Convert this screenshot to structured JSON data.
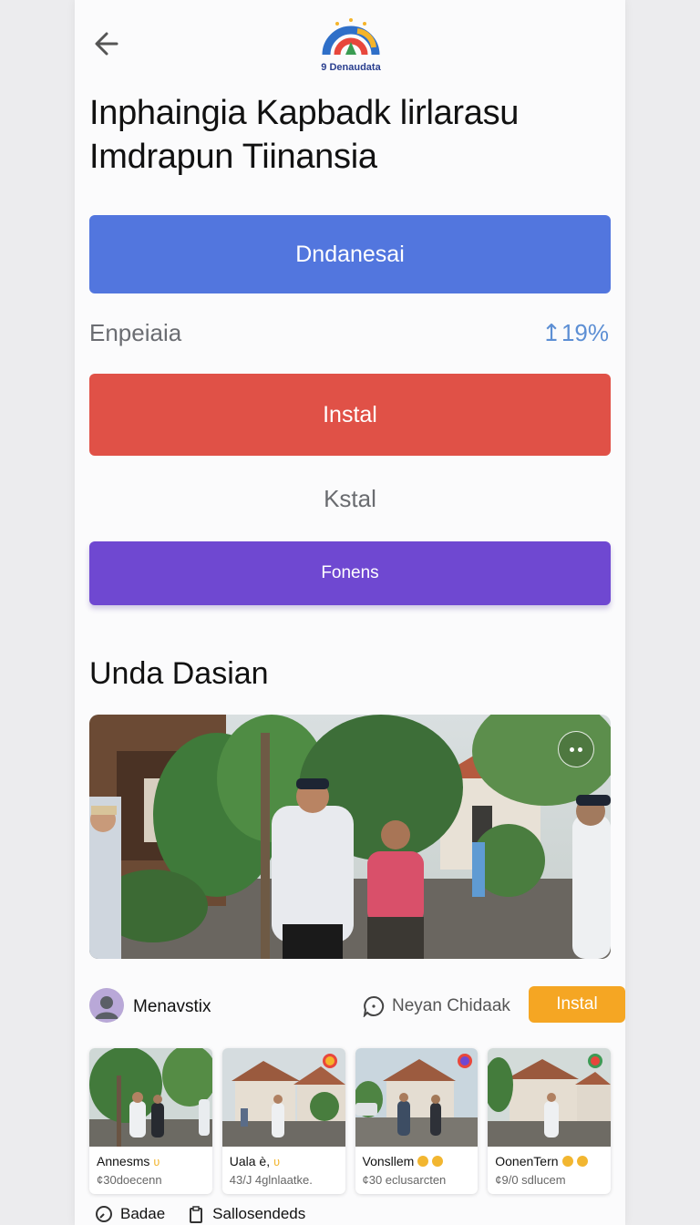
{
  "header": {
    "logo_text": "9 Denaudata",
    "title_line1": "Inphaingia  Kapbadk  lirlarasu",
    "title_line2": "Imdrapun Tiinansia"
  },
  "actions": {
    "primary_label": "Dndanesai",
    "stat_label": "Enpeiaia",
    "stat_value": "↥19%",
    "install_label": "Instal",
    "secondary_link": "Kstal",
    "purple_label": "Fonens"
  },
  "section": {
    "title": "Unda Dasian"
  },
  "post": {
    "author": "Menavstix",
    "comment_label": "Neyan Chidaak",
    "install_label": "Instal"
  },
  "thumbnails": [
    {
      "name": "Annesms",
      "meta": "¢30doecenn"
    },
    {
      "name": "Uala è,",
      "meta": "43/J 4glnlaatke."
    },
    {
      "name": "Vonsllem",
      "meta": "¢30  eclusarcten"
    },
    {
      "name": "OonenTern",
      "meta": "¢9/0  sdlucem"
    }
  ],
  "bottom_bar": {
    "item1": "Badae",
    "item2": "Sallosendeds"
  },
  "colors": {
    "blue": "#5276de",
    "red": "#e05147",
    "purple": "#6f48d1",
    "orange": "#f5a623",
    "stat": "#5d8fd4"
  },
  "icons": [
    "back-arrow-icon",
    "logo-icon",
    "more-icon",
    "comment-icon",
    "coin-icon",
    "clock-icon",
    "clipboard-icon"
  ]
}
